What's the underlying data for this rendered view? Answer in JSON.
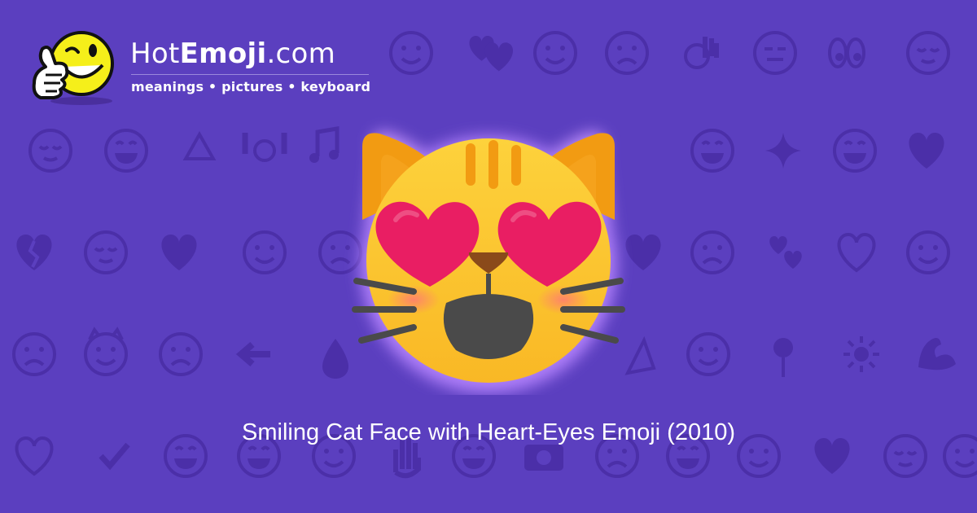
{
  "site": {
    "name_prefix": "Hot",
    "name_bold": "Emoji",
    "name_suffix": ".com",
    "tagline": "meanings • pictures • keyboard"
  },
  "emoji": {
    "name": "smiling-cat-face-with-heart-eyes",
    "caption": "Smiling Cat Face with Heart-Eyes Emoji (2010)"
  },
  "colors": {
    "background": "#5b3fbf",
    "pattern": "#4b2fa8",
    "cat_face": "#fbc02d",
    "cat_ears": "#f29b12",
    "hearts": "#e91e63",
    "glow": "#ad7cf3",
    "text": "#ffffff"
  },
  "background_icons": [
    "heart-icon",
    "winking-face-icon",
    "heart-icon",
    "smiling-face-icon",
    "angry-face-icon",
    "winking-face-icon",
    "smiling-face-icon",
    "two-hearts-icon",
    "smiling-face-icon",
    "weary-face-icon",
    "ok-hand-icon",
    "neutral-face-icon",
    "eyes-icon",
    "smirking-face-icon",
    "relieved-face-icon",
    "grimacing-face-icon",
    "recycle-icon",
    "raising-hands-icon",
    "music-notes-icon",
    "crying-cat-face-icon",
    "grinning-face-icon",
    "sparkles-icon",
    "grinning-face-icon",
    "heart-icon",
    "broken-heart-icon",
    "confused-face-icon",
    "heart-icon",
    "winking-face-icon",
    "frowning-face-icon",
    "heart-arrow-icon",
    "weary-face-icon",
    "revolving-hearts-icon",
    "heart-icon",
    "monkey-icon",
    "screaming-face-icon",
    "smiling-imp-icon",
    "angry-face-icon",
    "arrow-left-icon",
    "fire-icon",
    "party-popper-icon",
    "tongue-face-icon",
    "rose-icon",
    "sun-icon",
    "flexed-biceps-icon",
    "heart-icon",
    "check-mark-icon",
    "grinning-face-icon",
    "grinning-face-icon",
    "heart-eyes-face-icon",
    "waving-hand-icon",
    "grimacing-face-icon",
    "camera-icon",
    "frowning-face-icon",
    "grinning-face-icon",
    "cold-face-icon",
    "beating-heart-icon",
    "relieved-face-icon",
    "kissing-face-icon"
  ]
}
